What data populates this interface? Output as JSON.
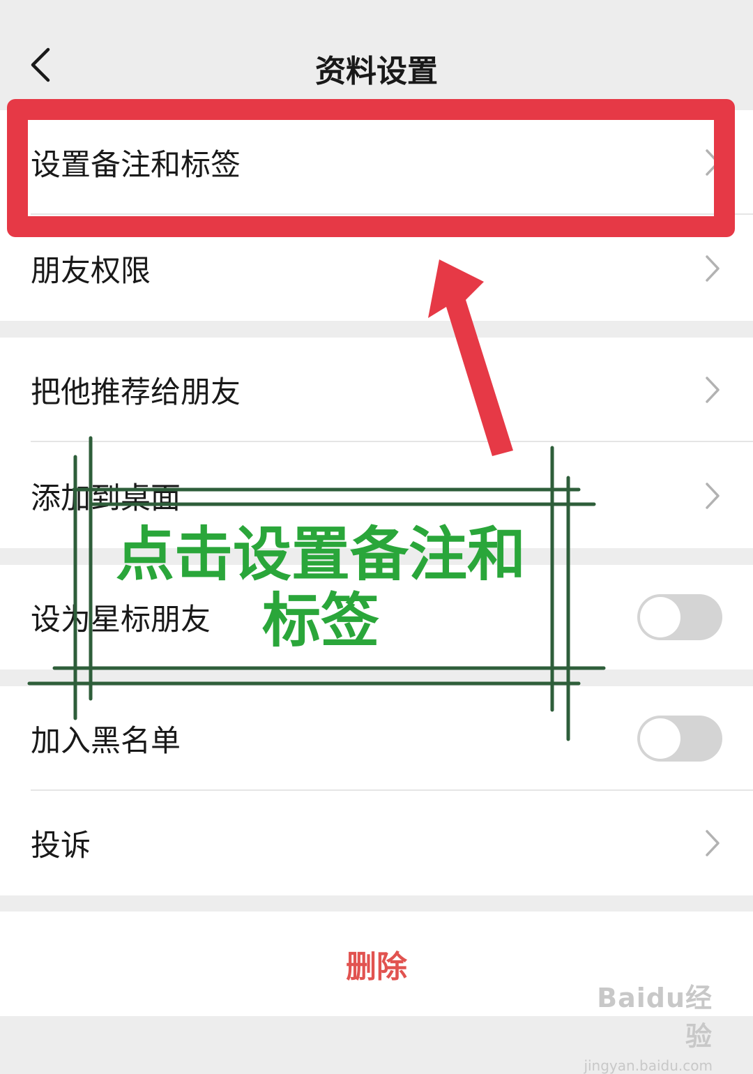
{
  "header": {
    "title": "资料设置",
    "back_icon": "chevron-left-icon"
  },
  "rows": [
    {
      "label": "设置备注和标签",
      "control": "chevron"
    },
    {
      "label": "朋友权限",
      "control": "chevron"
    },
    {
      "label": "把他推荐给朋友",
      "control": "chevron"
    },
    {
      "label": "添加到桌面",
      "control": "chevron"
    },
    {
      "label": "设为星标朋友",
      "control": "toggle",
      "on": false
    },
    {
      "label": "加入黑名单",
      "control": "toggle",
      "on": false
    },
    {
      "label": "投诉",
      "control": "chevron"
    }
  ],
  "delete_label": "删除",
  "annotation": {
    "line1": "点击设置备注和",
    "line2": "标签"
  },
  "watermark": {
    "logo": "Baidu经验",
    "url": "jingyan.baidu.com"
  },
  "colors": {
    "background": "#ededed",
    "delete_text": "#e15350",
    "highlight": "#e63946",
    "annotation_text": "#2aa63a",
    "annotation_lines": "#2e5e3a"
  }
}
